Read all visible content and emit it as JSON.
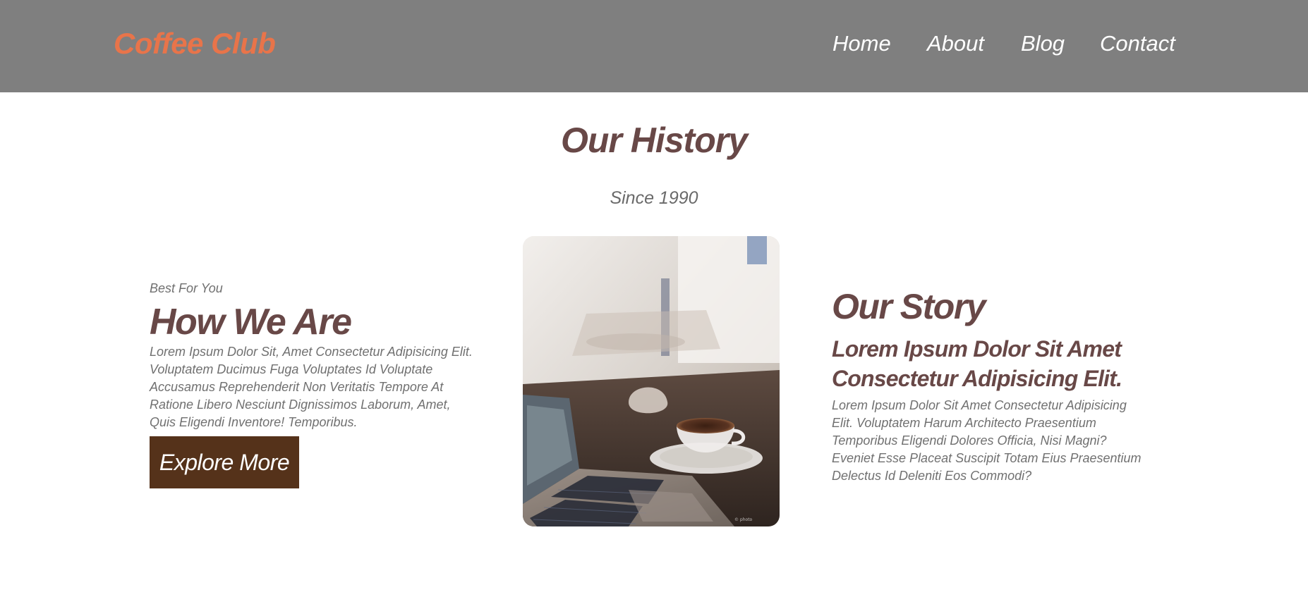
{
  "header": {
    "logo": "Coffee Club",
    "nav": [
      {
        "label": "Home"
      },
      {
        "label": "About"
      },
      {
        "label": "Blog"
      },
      {
        "label": "Contact"
      }
    ]
  },
  "history": {
    "title": "Our History",
    "subtitle": "Since 1990"
  },
  "about": {
    "eyebrow": "Best For You",
    "heading": "How We Are",
    "text": "Lorem Ipsum Dolor Sit, Amet Consectetur Adipisicing Elit. Voluptatem Ducimus Fuga Voluptates Id Voluptate Accusamus Reprehenderit Non Veritatis Tempore At Ratione Libero Nesciunt Dignissimos Laborum, Amet, Quis Eligendi Inventore! Temporibus.",
    "button_label": "Explore More"
  },
  "story": {
    "heading": "Our Story",
    "subheading": "Lorem Ipsum Dolor Sit Amet Consectetur Adipisicing Elit.",
    "text": "Lorem Ipsum Dolor Sit Amet Consectetur Adipisicing Elit. Voluptatem Harum Architecto Praesentium Temporibus Eligendi Dolores Officia, Nisi Magni? Eveniet Esse Placeat Suscipit Totam Eius Praesentium Delectus Id Deleniti Eos Commodi?"
  },
  "image": {
    "subject": "laptop and espresso cup on cafe table"
  },
  "colors": {
    "header_bg": "#7f7f7f",
    "logo": "#e8744a",
    "heading": "#684847",
    "body_text": "#707070",
    "button_bg": "#55321a"
  }
}
